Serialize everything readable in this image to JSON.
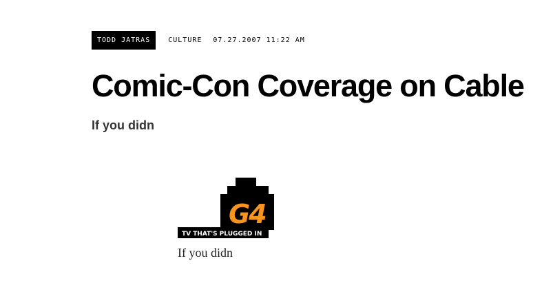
{
  "article": {
    "author": "TODD JATRAS",
    "category": "CULTURE",
    "date": "07.27.2007 11:22 AM",
    "title": "Comic-Con Coverage on Cable",
    "subtitle": "If you didn",
    "body_text": "If you didn"
  },
  "logo": {
    "mark": "G4",
    "tagline": "TV THAT'S PLUGGED IN",
    "mark_color": "#f7941d",
    "background_color": "#000000"
  }
}
